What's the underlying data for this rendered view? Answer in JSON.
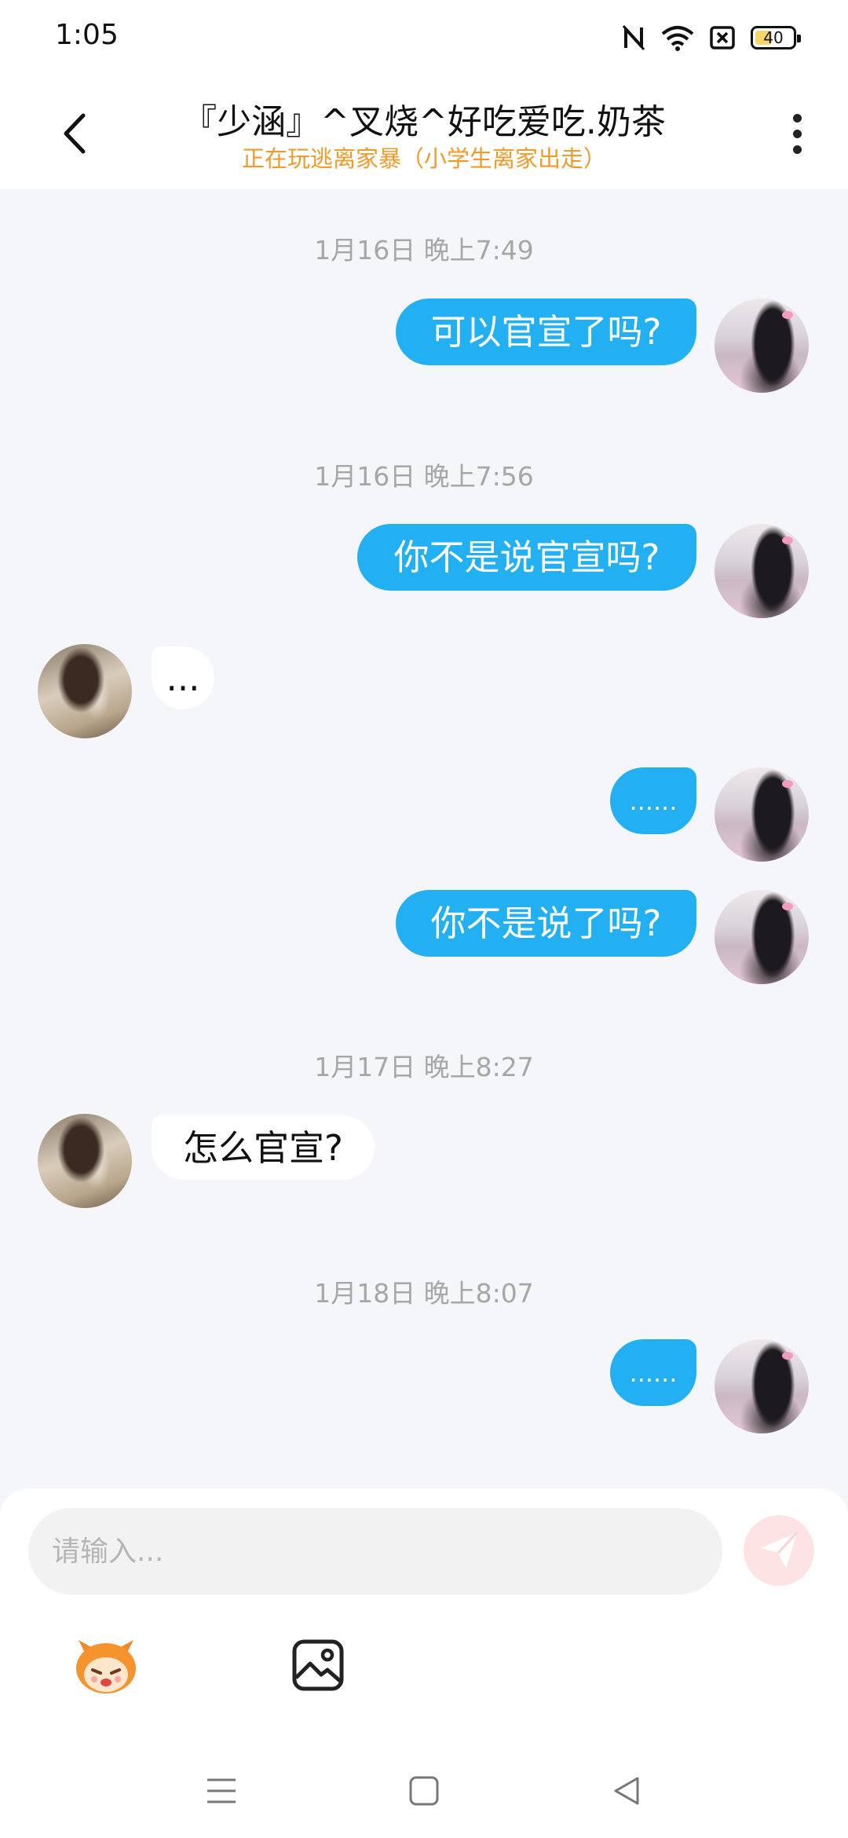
{
  "status_bar": {
    "time": "1:05",
    "battery": "40",
    "icons": [
      "nfc-icon",
      "wifi-icon",
      "sim-off-icon",
      "battery-icon"
    ]
  },
  "header": {
    "title": "『少涵』^叉烧^好吃爱吃.奶茶",
    "subtitle": "正在玩逃离家暴（小学生离家出走）",
    "back_icon": "chevron-left-icon",
    "menu_icon": "more-vertical-icon"
  },
  "messages": {
    "t1": "1月16日 晚上7:49",
    "m1": "可以官宣了吗?",
    "t2": "1月16日 晚上7:56",
    "m2": "你不是说官宣吗?",
    "m3": "...",
    "m4": "......",
    "m5": "你不是说了吗?",
    "t3": "1月17日 晚上8:27",
    "m6": "怎么官宣?",
    "t4": "1月18日 晚上8:07",
    "m7": "......"
  },
  "input": {
    "placeholder": "请输入...",
    "value": ""
  },
  "toolbar": {
    "icons": [
      "mascot-sticker-icon",
      "image-icon",
      "send-icon"
    ]
  },
  "nav_bar": {
    "icons": [
      "menu-icon",
      "home-icon",
      "back-icon"
    ]
  },
  "colors": {
    "my_bubble": "#22b0f3",
    "other_bubble": "#ffffff",
    "subtitle": "#f09a2a",
    "background": "#f4f6f9",
    "send_button": "#fde3e3"
  }
}
